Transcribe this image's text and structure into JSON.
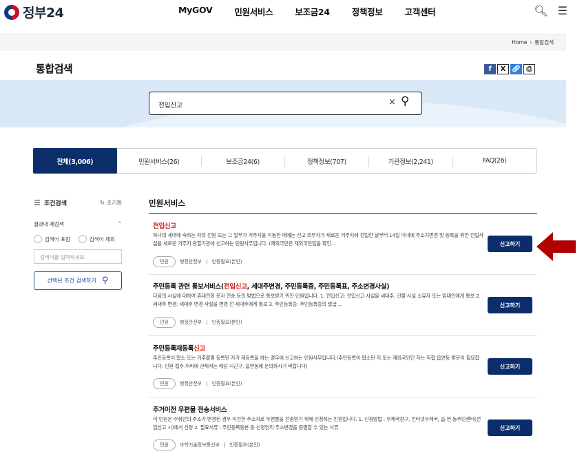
{
  "header": {
    "logo_text": "정부24",
    "nav": [
      "MyGOV",
      "민원서비스",
      "보조금24",
      "정책정보",
      "고객센터"
    ]
  },
  "breadcrumb": {
    "home": "Home",
    "sep": "›",
    "current": "통합검색"
  },
  "page_title": "통합검색",
  "search": {
    "value": "전입신고",
    "clear": "×",
    "button_icon": "search-icon"
  },
  "tabs": [
    {
      "label": "전체(3,006)",
      "active": true
    },
    {
      "label": "민원서비스(26)"
    },
    {
      "label": "보조금24(6)"
    },
    {
      "label": "정책정보(707)"
    },
    {
      "label": "기관정보(2,241)"
    },
    {
      "label": "FAQ(26)"
    }
  ],
  "sidebar": {
    "title": "조건검색",
    "reset": "초기화",
    "refine_label": "결과내 재검색",
    "option_include": "검색어 포함",
    "option_exclude": "검색어 제외",
    "input_placeholder": "검색어를 입력하세요.",
    "search_button": "선택된 조건 검색하기"
  },
  "results": {
    "section_title": "민원서비스",
    "items": [
      {
        "title_pre": "",
        "title_hl": "전입신고",
        "title_post": "",
        "desc": "하나의 세대에 속하는 자의 전원 또는 그 일부가 거주지를 이동한 때에는 신고 의무자가 새로운 거주지에 전입한 날부터 14일 이내에 주소지변경 및 등록을 위한 전입사실을 새로운 거주지 관할기관에 신고하는 민원사무입니다. (재외국민은 재외국민임을 확인…",
        "tag": "민원",
        "agency": "행정안전부",
        "auth": "인증필요(본인)",
        "button": "신고하기"
      },
      {
        "title_pre": "주민등록 관련 통보서비스(",
        "title_hl": "전입신고",
        "title_post": ", 세대주변경, 주민등록증, 주민등록표, 주소변경사실)",
        "desc": "다음의 사실에 대하여 휴대전화 문자 전송 등의 방법으로 통보받기 위한 민원입니다. 1. 전입신고: 전입신고 사실을 세대주, 건물·시설 소유자 또는 임대인에게 통보 2. 세대주 변경: 세대주 변경 사실을 변경 전 세대주에게 통보 3. 주민등록증: 주민등록증의 발급…",
        "tag": "민원",
        "agency": "행정안전부",
        "auth": "인증필요(본인)",
        "button": "신고하기"
      },
      {
        "title_pre": "주민등록재등록",
        "title_hl": "신고",
        "title_post": "",
        "desc": "주민등록이 말소 또는 거주불명 등록된 자가 재등록을 하는 경우에 신고하는 민원사무입니다.(주민등록이 말소된 지 또는 재외국민인 자는 직접 읍면동 방문이 필요합니다. 민원 접수·처리에 관해서는 해당 시군구, 읍면동에 문의하시기 바랍니다)",
        "tag": "민원",
        "agency": "행정안전부",
        "auth": "인증필요(본인)",
        "button": "신고하기"
      },
      {
        "title_pre": "주거이전 우편물 전송서비스",
        "title_hl": "",
        "title_post": "",
        "desc": "이 민원은 수취인의 주소가 변경된 경우 이전한 주소지로 우편물을 전송받기 위해 신청하는 민원입니다. 1. 신청방법 : 우체국창구, 인터넷우체국, 읍·면·동주민센터(전입신고 시)에서 신청 2. 필요서류 : 주민등록등본 등 신청인의 주소변경을 증명할 수 있는 서류",
        "tag": "민원",
        "agency": "과학기술정보통신부",
        "auth": "인증필요(본인)",
        "button": "신고하기"
      }
    ]
  },
  "colors": {
    "primary": "#0b2e6b",
    "highlight": "#d21f1f",
    "annotation_arrow": "#b00000"
  }
}
